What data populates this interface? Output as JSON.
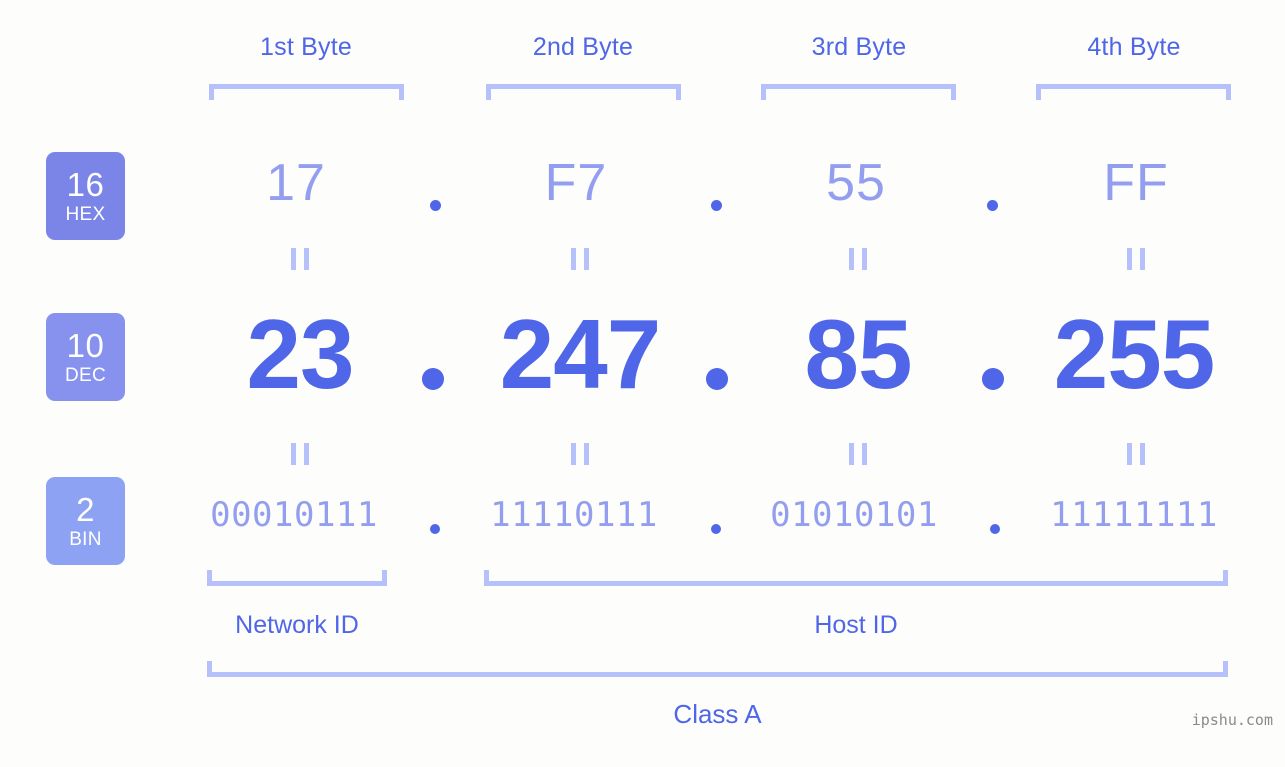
{
  "diagram": {
    "ip_address": "23.247.85.255",
    "class_label": "Class A",
    "watermark": "ipshu.com",
    "separator": ".",
    "equals_symbol": "=",
    "colors": {
      "background": "#fdfefb",
      "accent": "#4f66e8",
      "accent_soft": "#949ef0",
      "bracket": "#b6c0fb",
      "badge_hex": "#7b85e8",
      "badge_dec": "#8692ee",
      "badge_bin": "#8ea2f3",
      "watermark": "#8a8a8a"
    }
  },
  "byte_headers": [
    {
      "label": "1st Byte"
    },
    {
      "label": "2nd Byte"
    },
    {
      "label": "3rd Byte"
    },
    {
      "label": "4th Byte"
    }
  ],
  "bases": [
    {
      "number": "16",
      "name": "HEX"
    },
    {
      "number": "10",
      "name": "DEC"
    },
    {
      "number": "2",
      "name": "BIN"
    }
  ],
  "rows": {
    "hex": {
      "base": "16",
      "base_name": "HEX",
      "values": [
        "17",
        "F7",
        "55",
        "FF"
      ]
    },
    "dec": {
      "base": "10",
      "base_name": "DEC",
      "values": [
        "23",
        "247",
        "85",
        "255"
      ]
    },
    "bin": {
      "base": "2",
      "base_name": "BIN",
      "values": [
        "00010111",
        "11110111",
        "01010101",
        "11111111"
      ]
    }
  },
  "segments": [
    {
      "label": "Network ID",
      "bytes": 1
    },
    {
      "label": "Host ID",
      "bytes": 3
    }
  ]
}
